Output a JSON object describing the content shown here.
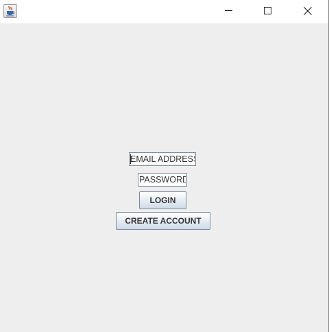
{
  "window": {
    "icon": "java-cup-icon",
    "controls": [
      "minimize-icon",
      "maximize-icon",
      "close-icon"
    ]
  },
  "form": {
    "email_value": "EMAIL ADDRESS",
    "password_value": "PASSWORD",
    "login_label": "LOGIN",
    "create_account_label": "CREATE ACCOUNT"
  }
}
